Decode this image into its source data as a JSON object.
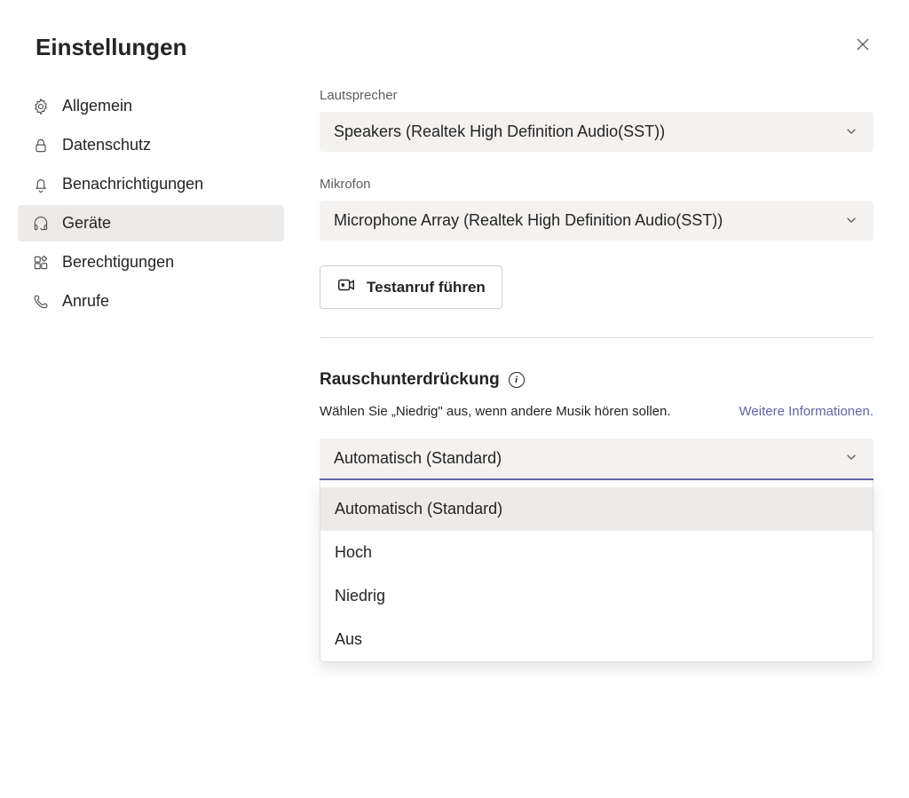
{
  "header": {
    "title": "Einstellungen"
  },
  "sidebar": {
    "items": [
      {
        "label": "Allgemein",
        "icon": "gear"
      },
      {
        "label": "Datenschutz",
        "icon": "lock"
      },
      {
        "label": "Benachrichtigungen",
        "icon": "bell"
      },
      {
        "label": "Geräte",
        "icon": "headphones"
      },
      {
        "label": "Berechtigungen",
        "icon": "apps"
      },
      {
        "label": "Anrufe",
        "icon": "phone"
      }
    ]
  },
  "main": {
    "speaker": {
      "label": "Lautsprecher",
      "value": "Speakers (Realtek High Definition Audio(SST))"
    },
    "microphone": {
      "label": "Mikrofon",
      "value": "Microphone Array (Realtek High Definition Audio(SST))"
    },
    "test_call": {
      "label": "Testanruf führen"
    },
    "noise": {
      "title": "Rauschunterdrückung",
      "helper": "Wählen Sie „Niedrig\" aus, wenn andere Musik hören sollen.",
      "link": "Weitere Informationen.",
      "value": "Automatisch (Standard)",
      "options": [
        "Automatisch (Standard)",
        "Hoch",
        "Niedrig",
        "Aus"
      ]
    }
  }
}
